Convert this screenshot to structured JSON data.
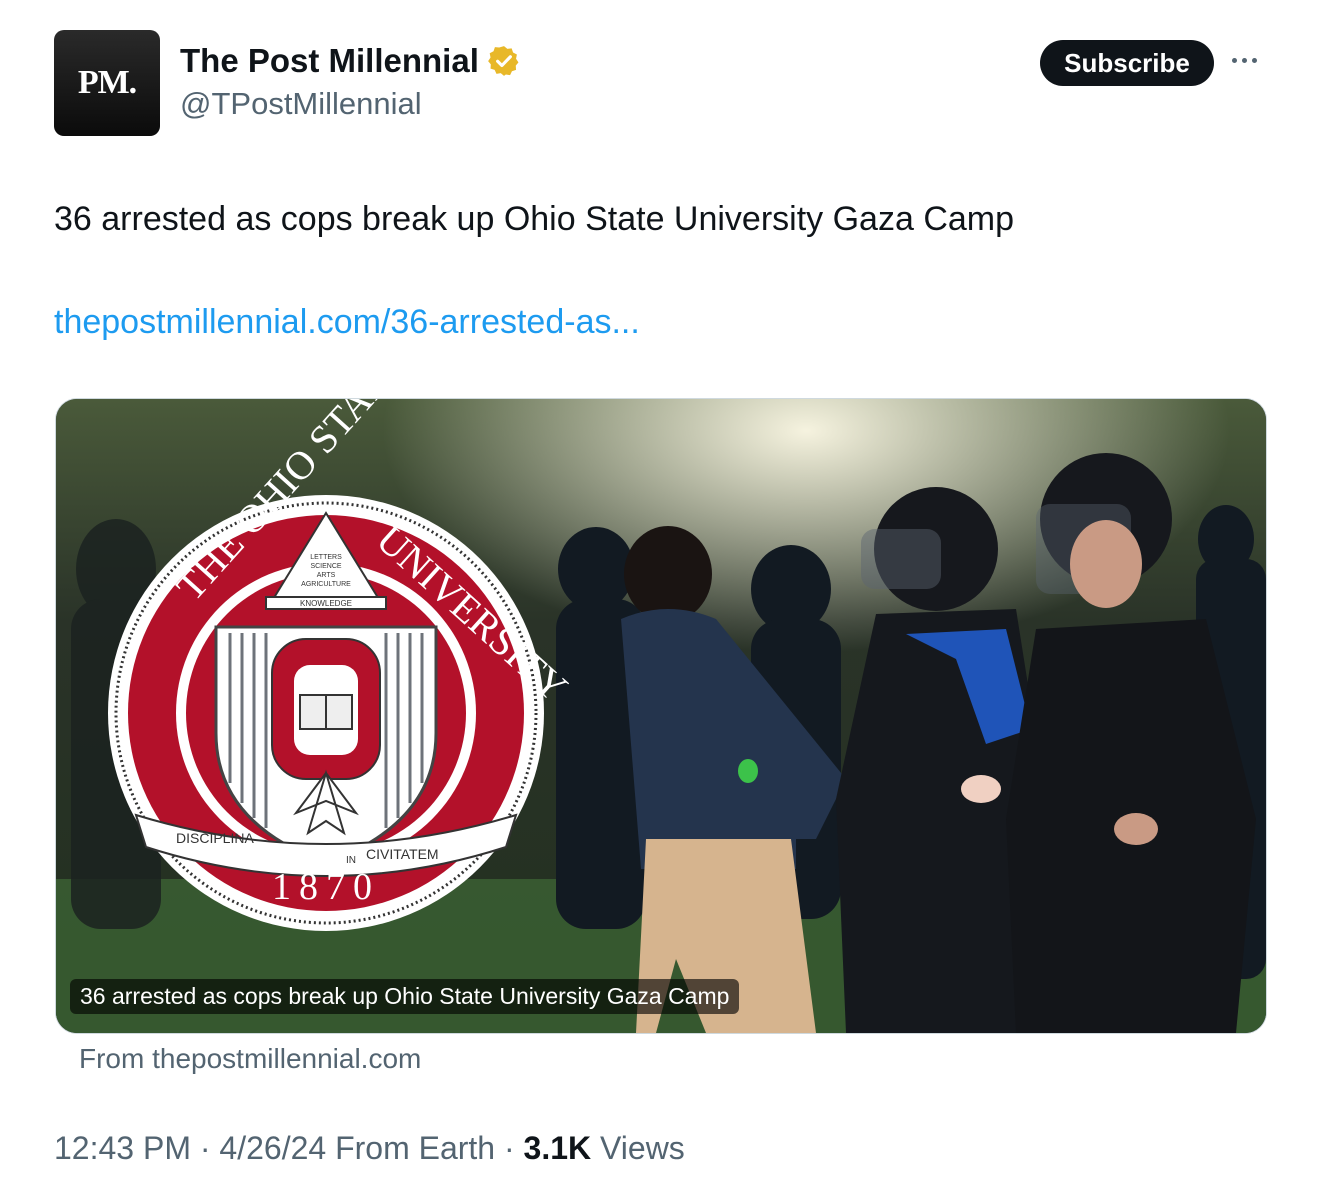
{
  "account": {
    "avatar_text": "PM.",
    "display_name": "The Post Millennial",
    "handle": "@TPostMillennial",
    "verified": true,
    "verified_color": "#e8b829"
  },
  "actions": {
    "subscribe_label": "Subscribe"
  },
  "tweet": {
    "text": "36 arrested as cops break up Ohio State University Gaza Camp",
    "link": "thepostmillennial.com/36-arrested-as..."
  },
  "card": {
    "caption": "36 arrested as cops break up Ohio State University Gaza Camp",
    "source": "From thepostmillennial.com",
    "seal": {
      "top_left": "THE OHIO STATE",
      "top_right": "UNIVERSITY",
      "torch_lines": [
        "LETTERS",
        "SCIENCE",
        "ARTS",
        "AGRICULTURE"
      ],
      "knowledge": "KNOWLEDGE",
      "motto_left": "DISCIPLINA",
      "motto_in": "IN",
      "motto_right": "CIVITATEM",
      "year": "1870",
      "colors": {
        "scarlet": "#b3112a",
        "gray": "#8a8f96"
      }
    }
  },
  "meta": {
    "time": "12:43 PM",
    "date": "4/26/24",
    "location": "From Earth",
    "views_count": "3.1K",
    "views_label": "Views"
  },
  "colors": {
    "link": "#1d9bf0",
    "secondary_text": "#536471",
    "primary_text": "#0f1419"
  }
}
